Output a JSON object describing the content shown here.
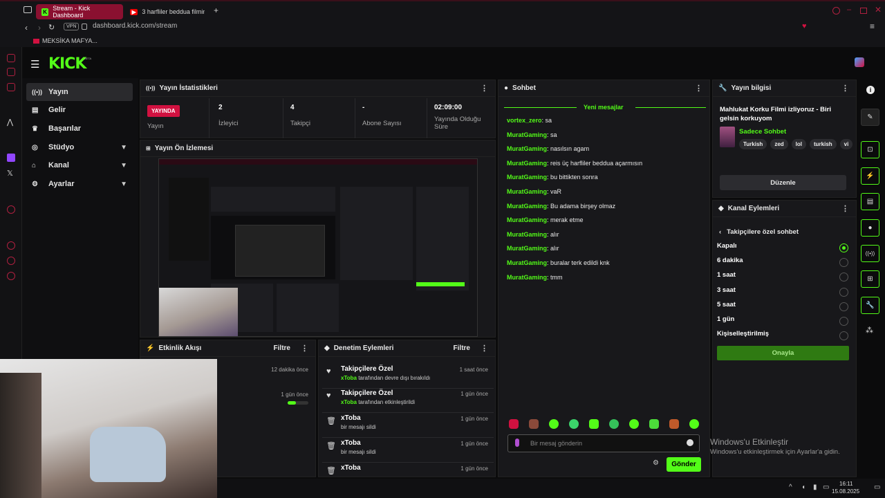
{
  "browser": {
    "tabs": [
      {
        "label": "Stream - Kick Dashboard"
      },
      {
        "label": "3 harfliler beddua filmini i..."
      }
    ],
    "new_tab": "+",
    "vpn_badge": "VPN",
    "url": "dashboard.kick.com/stream",
    "bookmark": "MEKSİKA MAFYA..."
  },
  "app": {
    "logo": "KICK",
    "logo_beta": "BETA"
  },
  "nav": {
    "items": [
      {
        "label": "Yayın",
        "icon": "broadcast-icon"
      },
      {
        "label": "Gelir",
        "icon": "money-icon"
      },
      {
        "label": "Başarılar",
        "icon": "trophy-icon"
      },
      {
        "label": "Stüdyo",
        "icon": "studio-icon"
      },
      {
        "label": "Kanal",
        "icon": "channel-icon"
      },
      {
        "label": "Ayarlar",
        "icon": "gear-icon"
      }
    ]
  },
  "stats": {
    "title": "Yayın İstatistikleri",
    "live_badge": "YAYINDA",
    "live_label": "Yayın",
    "items": [
      {
        "value": "2",
        "label": "İzleyici"
      },
      {
        "value": "4",
        "label": "Takipçi"
      },
      {
        "value": "-",
        "label": "Abone Sayısı"
      },
      {
        "value": "02:09:00",
        "label": "Yayında Olduğu Süre"
      }
    ]
  },
  "preview": {
    "title": "Yayın Ön İzlemesi"
  },
  "activity": {
    "title": "Etkinlik Akışı",
    "filter": "Filtre",
    "items": [
      {
        "time": "12 dakika önce"
      },
      {
        "time": "1 gün önce"
      }
    ]
  },
  "moderation": {
    "title": "Denetim Eylemleri",
    "filter": "Filtre",
    "items": [
      {
        "title": "Takipçilere Özel",
        "user": "xToba",
        "action": "tarafından devre dışı bırakıldı",
        "time": "1 saat önce"
      },
      {
        "title": "Takipçilere Özel",
        "user": "xToba",
        "action": "tarafından etkinleştirildi",
        "time": "1 gün önce"
      },
      {
        "title": "xToba",
        "user": "",
        "action": "bir mesajı sildi",
        "time": "1 gün önce"
      },
      {
        "title": "xToba",
        "user": "",
        "action": "bir mesajı sildi",
        "time": "1 gün önce"
      },
      {
        "title": "xToba",
        "user": "",
        "action": "",
        "time": "1 gün önce"
      }
    ]
  },
  "chat": {
    "title": "Sohbet",
    "new_messages": "Yeni mesajlar",
    "messages": [
      {
        "user": "vortex_zero",
        "text": "sa"
      },
      {
        "user": "MuratGaming",
        "text": "sa"
      },
      {
        "user": "MuratGaming",
        "text": "nasılsın agam"
      },
      {
        "user": "MuratGaming",
        "text": "reis üç harfliler beddua açarmısın"
      },
      {
        "user": "MuratGaming",
        "text": "bu bittikten sonra"
      },
      {
        "user": "MuratGaming",
        "text": "vaR"
      },
      {
        "user": "MuratGaming",
        "text": "Bu adama birşey olmaz"
      },
      {
        "user": "MuratGaming",
        "text": "merak etme"
      },
      {
        "user": "MuratGaming",
        "text": "alır"
      },
      {
        "user": "MuratGaming",
        "text": "alır"
      },
      {
        "user": "MuratGaming",
        "text": "buralar terk edildi knk"
      },
      {
        "user": "MuratGaming",
        "text": "tmm"
      }
    ],
    "placeholder": "Bir mesaj gönderin",
    "send": "Gönder"
  },
  "info": {
    "title": "Yayın bilgisi",
    "stream_title": "Mahlukat Korku Filmi izliyoruz - Biri gelsin korkuyom",
    "category": "Sadece Sohbet",
    "tags": [
      "Turkish",
      "zed",
      "lol",
      "turkish",
      "vi"
    ],
    "edit": "Düzenle"
  },
  "channel_actions": {
    "title": "Kanal Eylemleri",
    "sub_title": "Takipçilere özel sohbet",
    "options": [
      {
        "label": "Kapalı",
        "selected": true
      },
      {
        "label": "6 dakika",
        "selected": false
      },
      {
        "label": "1 saat",
        "selected": false
      },
      {
        "label": "3 saat",
        "selected": false
      },
      {
        "label": "5 saat",
        "selected": false
      },
      {
        "label": "1 gün",
        "selected": false
      },
      {
        "label": "Kişiselleştirilmiş",
        "selected": false
      }
    ],
    "confirm": "Onayla"
  },
  "windows": {
    "activate_title": "Windows'u Etkinleştir",
    "activate_sub": "Windows'u etkinleştirmek için Ayarlar'a gidin.",
    "time": "16:11",
    "date": "15.08.2025"
  },
  "colors": {
    "accent": "#53fc18",
    "live": "#d11140",
    "panel": "#18181b"
  }
}
